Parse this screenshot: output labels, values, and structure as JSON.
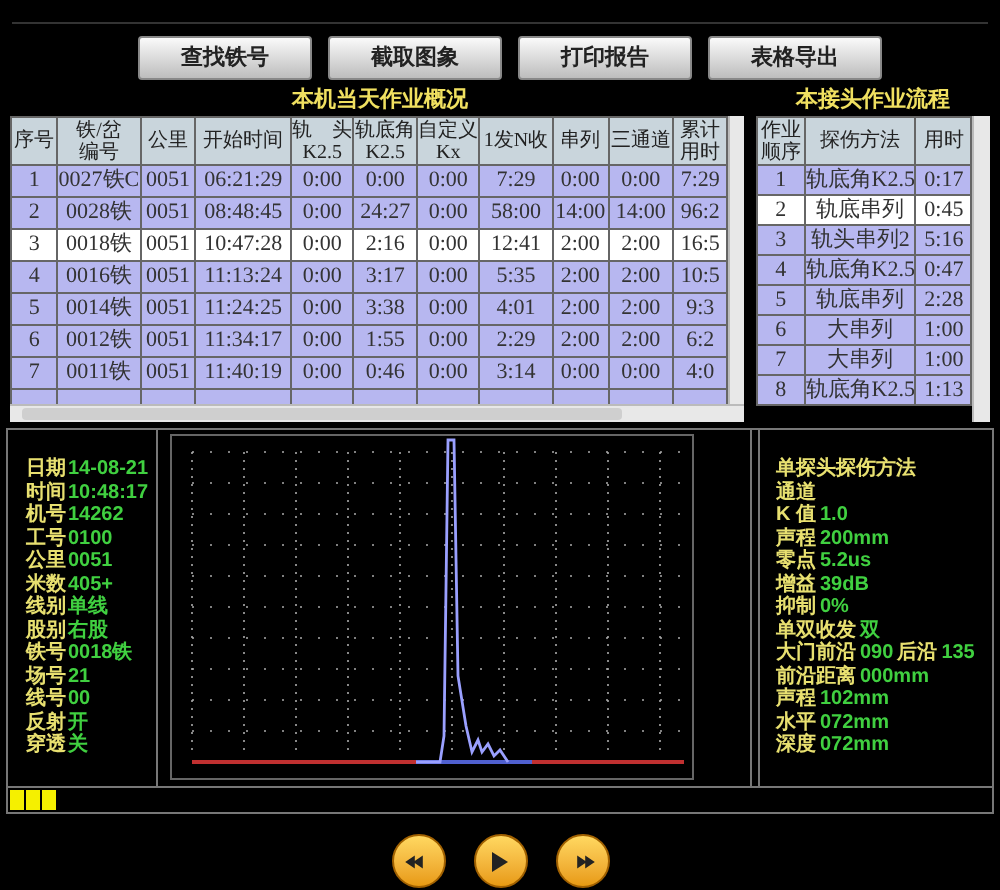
{
  "toolbar": {
    "buttons": [
      "查找铁号",
      "截取图象",
      "打印报告",
      "表格导出"
    ]
  },
  "daily_summary": {
    "title": "本机当天作业概况",
    "columns": [
      "序号",
      "铁/岔编号",
      "公里",
      "开始时间",
      "轨　头\nK2.5",
      "轨底角\nK2.5",
      "自定义\nKx",
      "1发N收",
      "串列",
      "三通道",
      "累计用时"
    ],
    "rows": [
      {
        "selected": false,
        "cells": [
          "1",
          "0027铁C",
          "0051",
          "06:21:29",
          "0:00",
          "0:00",
          "0:00",
          "7:29",
          "0:00",
          "0:00",
          "7:29"
        ]
      },
      {
        "selected": false,
        "cells": [
          "2",
          "0028铁",
          "0051",
          "08:48:45",
          "0:00",
          "24:27",
          "0:00",
          "58:00",
          "14:00",
          "14:00",
          "96:2"
        ]
      },
      {
        "selected": true,
        "cells": [
          "3",
          "0018铁",
          "0051",
          "10:47:28",
          "0:00",
          "2:16",
          "0:00",
          "12:41",
          "2:00",
          "2:00",
          "16:5"
        ]
      },
      {
        "selected": false,
        "cells": [
          "4",
          "0016铁",
          "0051",
          "11:13:24",
          "0:00",
          "3:17",
          "0:00",
          "5:35",
          "2:00",
          "2:00",
          "10:5"
        ]
      },
      {
        "selected": false,
        "cells": [
          "5",
          "0014铁",
          "0051",
          "11:24:25",
          "0:00",
          "3:38",
          "0:00",
          "4:01",
          "2:00",
          "2:00",
          "9:3"
        ]
      },
      {
        "selected": false,
        "cells": [
          "6",
          "0012铁",
          "0051",
          "11:34:17",
          "0:00",
          "1:55",
          "0:00",
          "2:29",
          "2:00",
          "2:00",
          "6:2"
        ]
      },
      {
        "selected": false,
        "cells": [
          "7",
          "0011铁",
          "0051",
          "11:40:19",
          "0:00",
          "0:46",
          "0:00",
          "3:14",
          "0:00",
          "0:00",
          "4:0"
        ]
      }
    ]
  },
  "joint_flow": {
    "title": "本接头作业流程",
    "columns": [
      "作业顺序",
      "探伤方法",
      "用时"
    ],
    "rows": [
      {
        "selected": false,
        "cells": [
          "1",
          "轨底角K2.5",
          "0:17"
        ]
      },
      {
        "selected": true,
        "cells": [
          "2",
          "轨底串列",
          "0:45"
        ]
      },
      {
        "selected": false,
        "cells": [
          "3",
          "轨头串列2",
          "5:16"
        ]
      },
      {
        "selected": false,
        "cells": [
          "4",
          "轨底角K2.5",
          "0:47"
        ]
      },
      {
        "selected": false,
        "cells": [
          "5",
          "轨底串列",
          "2:28"
        ]
      },
      {
        "selected": false,
        "cells": [
          "6",
          "大串列",
          "1:00"
        ]
      },
      {
        "selected": false,
        "cells": [
          "7",
          "大串列",
          "1:00"
        ]
      },
      {
        "selected": false,
        "cells": [
          "8",
          "轨底角K2.5",
          "1:13"
        ]
      }
    ]
  },
  "info_left": [
    {
      "label": "日期",
      "value": "14-08-21"
    },
    {
      "label": "时间",
      "value": "10:48:17"
    },
    {
      "label": "机号",
      "value": "14262"
    },
    {
      "label": "工号",
      "value": "0100"
    },
    {
      "label": "公里",
      "value": "0051"
    },
    {
      "label": "米数",
      "value": "405+"
    },
    {
      "label": "线别",
      "value": "单线"
    },
    {
      "label": "股别",
      "value": "右股"
    },
    {
      "label": "铁号",
      "value": "0018铁"
    },
    {
      "label": "场号",
      "value": "21"
    },
    {
      "label": "线号",
      "value": "00"
    },
    {
      "label": "反射",
      "value": "开"
    },
    {
      "label": "穿透",
      "value": "关"
    }
  ],
  "info_right": [
    {
      "parts": [
        {
          "kind": "label",
          "text": "单探头探伤方法"
        }
      ]
    },
    {
      "parts": [
        {
          "kind": "label",
          "text": "通道"
        }
      ]
    },
    {
      "parts": [
        {
          "kind": "label",
          "text": "K 值"
        },
        {
          "kind": "value",
          "text": "1.0"
        }
      ]
    },
    {
      "parts": [
        {
          "kind": "label",
          "text": "声程"
        },
        {
          "kind": "value",
          "text": "200mm"
        }
      ]
    },
    {
      "parts": [
        {
          "kind": "label",
          "text": "零点"
        },
        {
          "kind": "value",
          "text": "5.2us"
        }
      ]
    },
    {
      "parts": [
        {
          "kind": "label",
          "text": "增益"
        },
        {
          "kind": "value",
          "text": "39dB"
        }
      ]
    },
    {
      "parts": [
        {
          "kind": "label",
          "text": "抑制"
        },
        {
          "kind": "value",
          "text": "0%"
        }
      ]
    },
    {
      "parts": [
        {
          "kind": "label",
          "text": "单双收发"
        },
        {
          "kind": "value",
          "text": "双"
        }
      ]
    },
    {
      "parts": [
        {
          "kind": "label",
          "text": "大门前沿"
        },
        {
          "kind": "value",
          "text": "090"
        },
        {
          "kind": "label",
          "text": "后沿"
        },
        {
          "kind": "value",
          "text": "135"
        }
      ]
    },
    {
      "parts": [
        {
          "kind": "label",
          "text": "前沿距离"
        },
        {
          "kind": "value",
          "text": "000mm"
        }
      ]
    },
    {
      "parts": [
        {
          "kind": "label",
          "text": "声程"
        },
        {
          "kind": "value",
          "text": "102mm"
        }
      ]
    },
    {
      "parts": [
        {
          "kind": "label",
          "text": "水平"
        },
        {
          "kind": "value",
          "text": "072mm"
        }
      ]
    },
    {
      "parts": [
        {
          "kind": "label",
          "text": "深度"
        },
        {
          "kind": "value",
          "text": "072mm"
        }
      ]
    }
  ],
  "playback": {
    "buttons": [
      {
        "kind": "rewind"
      },
      {
        "kind": "play"
      },
      {
        "kind": "forward"
      }
    ]
  }
}
